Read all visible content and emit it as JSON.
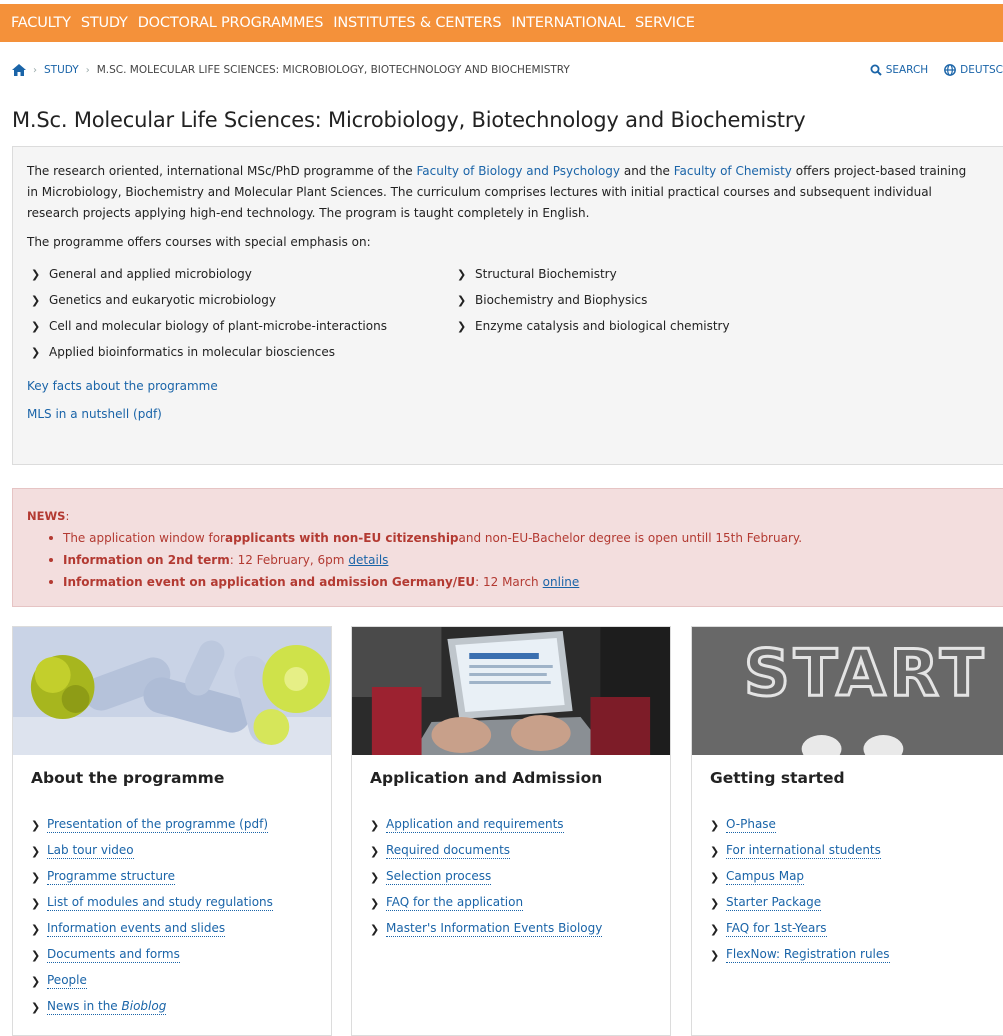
{
  "nav": {
    "items": [
      "FACULTY",
      "STUDY",
      "DOCTORAL PROGRAMMES",
      "INSTITUTES & CENTERS",
      "INTERNATIONAL",
      "SERVICE"
    ]
  },
  "breadcrumb": {
    "items": [
      "STUDY",
      "M.SC. MOLECULAR LIFE SCIENCES: MICROBIOLOGY, BIOTECHNOLOGY AND BIOCHEMISTRY"
    ]
  },
  "tools": {
    "search": "SEARCH",
    "language": "DEUTSC"
  },
  "page": {
    "title": "M.Sc. Molecular Life Sciences: Microbiology, Biotechnology and Biochemistry"
  },
  "intro": {
    "p1_a": "The research oriented, international MSc/PhD programme of the ",
    "p1_link1": "Faculty of Biology and Psychology",
    "p1_b": " and the ",
    "p1_link2": "Faculty of Chemisty",
    "p1_c": " offers project-based training in Microbiology, Biochemistry and Molecular Plant Sciences. The curriculum comprises lectures with initial practical courses and subsequent individual research projects applying high-end technology. The program is taught completely in English.",
    "p2": "The programme offers courses with special emphasis on:",
    "left_items": [
      "General and applied microbiology",
      "Genetics and eukaryotic microbiology",
      "Cell and molecular biology of plant-microbe-interactions",
      "Applied bioinformatics in molecular biosciences"
    ],
    "right_items": [
      "Structural Biochemistry",
      "Biochemistry and Biophysics",
      "Enzyme catalysis and biological chemistry"
    ],
    "link_keyfacts": "Key facts about the programme",
    "link_nutshell": "MLS in a nutshell (pdf)"
  },
  "news": {
    "label": "NEWS",
    "colon": ":",
    "item1_a": "The application window for ",
    "item1_b": "applicants with non-EU citizenship",
    "item1_c": " and non-EU-Bachelor degree is open untill 15th February.",
    "item2_b": "Information on 2nd term",
    "item2_c": ": 12 February, 6pm",
    "item2_link": "details",
    "item3_b": "Information event on application and admission Germany/EU",
    "item3_c": ": 12 March",
    "item3_link": "online"
  },
  "cards": [
    {
      "title": "About the programme",
      "links": [
        "Presentation of the programme (pdf)",
        "Lab tour video",
        "Programme structure",
        "List of modules and study regulations",
        "Information events and slides",
        "Documents and forms",
        "People"
      ],
      "last_link_a": "News in the ",
      "last_link_em": "Bioblog"
    },
    {
      "title": "Application and Admission",
      "links": [
        "Application and requirements",
        "Required documents",
        "Selection process",
        "FAQ for the application",
        "Master's Information Events Biology"
      ]
    },
    {
      "title": "Getting started",
      "image_text": "START",
      "links": [
        "O-Phase",
        "For international students",
        "Campus Map",
        "Starter Package",
        "FAQ for 1st-Years",
        "FlexNow: Registration rules"
      ]
    }
  ],
  "colors": {
    "nav_bg": "#f4913a",
    "link": "#1a64a8",
    "news_bg": "#f3dede",
    "news_text": "#b33a32",
    "panel_bg": "#f5f5f5"
  }
}
